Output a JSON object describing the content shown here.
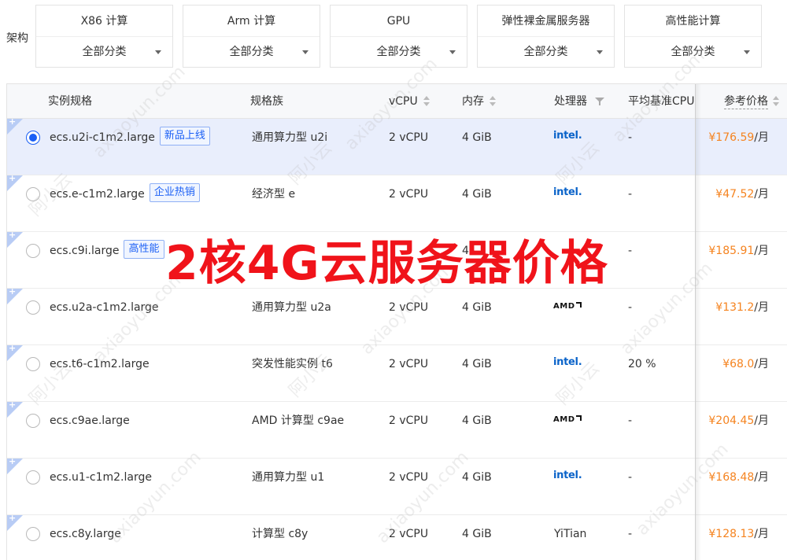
{
  "filter": {
    "label": "架构",
    "options": [
      {
        "title": "X86 计算",
        "selected": "全部分类"
      },
      {
        "title": "Arm 计算",
        "selected": "全部分类"
      },
      {
        "title": "GPU",
        "selected": "全部分类"
      },
      {
        "title": "弹性裸金属服务器",
        "selected": "全部分类"
      },
      {
        "title": "高性能计算",
        "selected": "全部分类"
      }
    ]
  },
  "table": {
    "headers": {
      "spec": "实例规格",
      "family": "规格族",
      "vcpu": "vCPU",
      "memory": "内存",
      "processor": "处理器",
      "baseline": "平均基准CPU",
      "price": "参考价格"
    },
    "rows": [
      {
        "spec": "ecs.u2i-c1m2.large",
        "tag": "新品上线",
        "family": "通用算力型 u2i",
        "vcpu": "2 vCPU",
        "memory": "4 GiB",
        "processor": "intel",
        "baseline": "-",
        "price": "¥176.59",
        "unit": "/月",
        "selected": true
      },
      {
        "spec": "ecs.e-c1m2.large",
        "tag": "企业热销",
        "family": "经济型 e",
        "vcpu": "2 vCPU",
        "memory": "4 GiB",
        "processor": "intel",
        "baseline": "-",
        "price": "¥47.52",
        "unit": "/月",
        "selected": false
      },
      {
        "spec": "ecs.c9i.large",
        "tag": "高性能",
        "family": "",
        "vcpu": "",
        "memory": "4",
        "processor": "",
        "baseline": "-",
        "price": "¥185.91",
        "unit": "/月",
        "selected": false
      },
      {
        "spec": "ecs.u2a-c1m2.large",
        "tag": "",
        "family": "通用算力型 u2a",
        "vcpu": "2 vCPU",
        "memory": "4 GiB",
        "processor": "amd",
        "baseline": "-",
        "price": "¥131.2",
        "unit": "/月",
        "selected": false
      },
      {
        "spec": "ecs.t6-c1m2.large",
        "tag": "",
        "family": "突发性能实例 t6",
        "vcpu": "2 vCPU",
        "memory": "4 GiB",
        "processor": "intel",
        "baseline": "20 %",
        "price": "¥68.0",
        "unit": "/月",
        "selected": false
      },
      {
        "spec": "ecs.c9ae.large",
        "tag": "",
        "family": "AMD 计算型 c9ae",
        "vcpu": "2 vCPU",
        "memory": "4 GiB",
        "processor": "amd",
        "baseline": "-",
        "price": "¥204.45",
        "unit": "/月",
        "selected": false
      },
      {
        "spec": "ecs.u1-c1m2.large",
        "tag": "",
        "family": "通用算力型 u1",
        "vcpu": "2 vCPU",
        "memory": "4 GiB",
        "processor": "intel",
        "baseline": "-",
        "price": "¥168.48",
        "unit": "/月",
        "selected": false
      },
      {
        "spec": "ecs.c8y.large",
        "tag": "",
        "family": "计算型 c8y",
        "vcpu": "2 vCPU",
        "memory": "4 GiB",
        "processor": "YiTian",
        "baseline": "-",
        "price": "¥128.13",
        "unit": "/月",
        "selected": false
      }
    ]
  },
  "logos": {
    "intel": "intel",
    "intel_dot": ".",
    "amd": "AMD"
  },
  "overlay": {
    "title": "2核4G云服务器价格"
  },
  "watermarks": {
    "cn": "阿小云",
    "en": "axiaoyun.com"
  },
  "colors": {
    "accent": "#1a5ff5",
    "price": "#f5831f",
    "overlay": "#f0131a",
    "selected_row": "#e9eefc"
  }
}
